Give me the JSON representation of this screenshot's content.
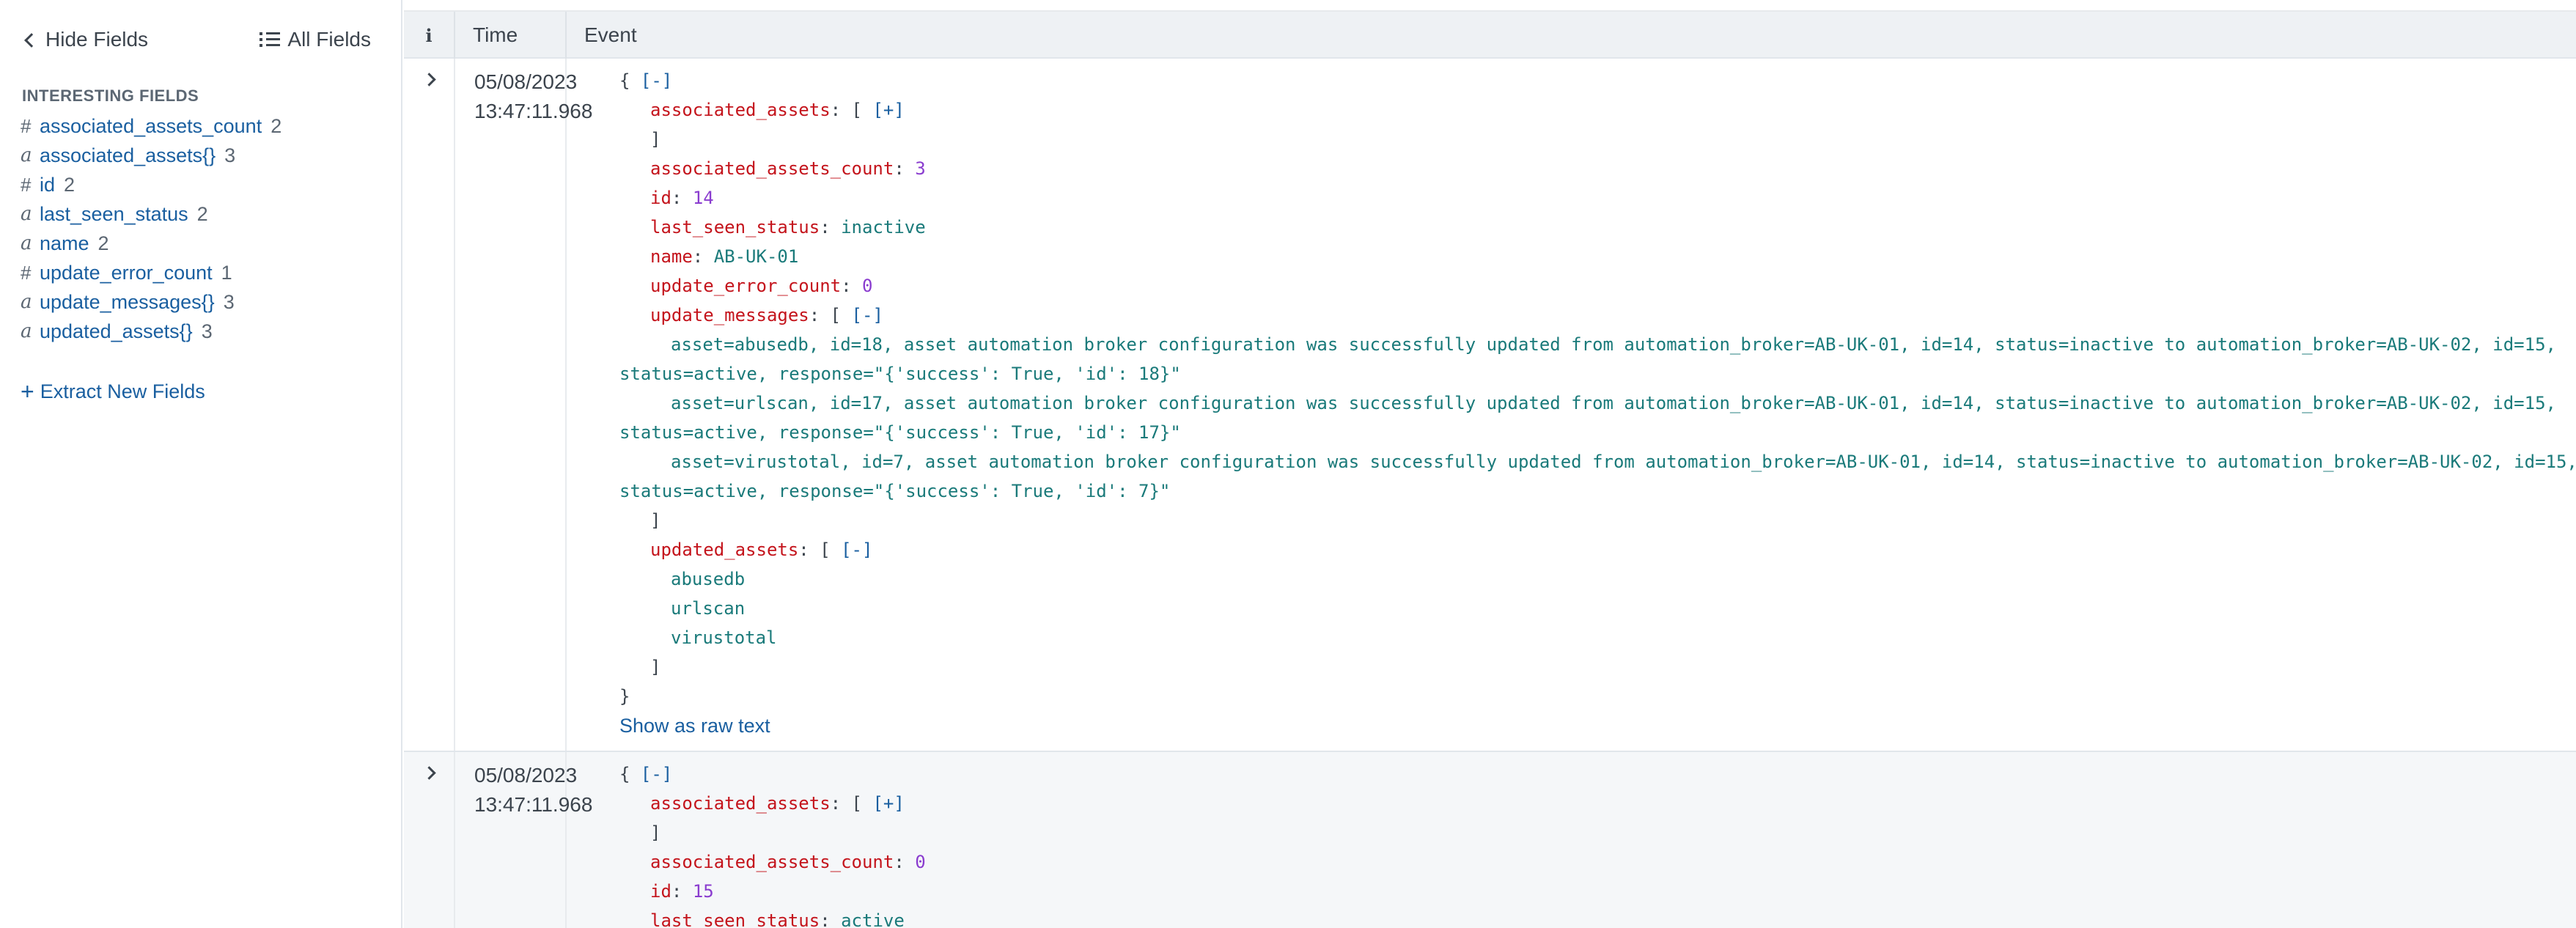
{
  "sidebar": {
    "hide_fields": "Hide Fields",
    "all_fields": "All Fields",
    "section_title": "INTERESTING FIELDS",
    "fields": [
      {
        "type": "#",
        "name": "associated_assets_count",
        "count": "2"
      },
      {
        "type": "a",
        "name": "associated_assets{}",
        "count": "3"
      },
      {
        "type": "#",
        "name": "id",
        "count": "2"
      },
      {
        "type": "a",
        "name": "last_seen_status",
        "count": "2"
      },
      {
        "type": "a",
        "name": "name",
        "count": "2"
      },
      {
        "type": "#",
        "name": "update_error_count",
        "count": "1"
      },
      {
        "type": "a",
        "name": "update_messages{}",
        "count": "3"
      },
      {
        "type": "a",
        "name": "updated_assets{}",
        "count": "3"
      }
    ],
    "extract": "Extract New Fields"
  },
  "table": {
    "col_info": "i",
    "col_time": "Time",
    "col_event": "Event"
  },
  "events": [
    {
      "date": "05/08/2023",
      "time": "13:47:11.968",
      "open_brace": "{",
      "collapse": "[-]",
      "expand": "[+]",
      "k_assoc": "associated_assets",
      "k_assoc_count": "associated_assets_count",
      "v_assoc_count": "3",
      "k_id": "id",
      "v_id": "14",
      "k_status": "last_seen_status",
      "v_status": "inactive",
      "k_name": "name",
      "v_name": "AB-UK-01",
      "k_err": "update_error_count",
      "v_err": "0",
      "k_msgs": "update_messages",
      "msgs": [
        {
          "a": "asset=abusedb, id=18, asset automation broker configuration was successfully updated from automation_broker=AB-UK-01, id=14, status=inactive to automation_broker=AB-UK-02, id=15,",
          "b": "status=active, response=\"{'success': True, 'id': 18}\""
        },
        {
          "a": "asset=urlscan, id=17, asset automation broker configuration was successfully updated from automation_broker=AB-UK-01, id=14, status=inactive to automation_broker=AB-UK-02, id=15,",
          "b": "status=active, response=\"{'success': True, 'id': 17}\""
        },
        {
          "a": "asset=virustotal, id=7, asset automation broker configuration was successfully updated from automation_broker=AB-UK-01, id=14, status=inactive to automation_broker=AB-UK-02, id=15,",
          "b": "status=active, response=\"{'success': True, 'id': 7}\""
        }
      ],
      "k_updated": "updated_assets",
      "updated": [
        "abusedb",
        "urlscan",
        "virustotal"
      ],
      "close_bracket": "]",
      "close_brace": "}",
      "raw": "Show as raw text"
    },
    {
      "date": "05/08/2023",
      "time": "13:47:11.968",
      "open_brace": "{",
      "collapse": "[-]",
      "expand": "[+]",
      "k_assoc": "associated_assets",
      "k_assoc_count": "associated_assets_count",
      "v_assoc_count": "0",
      "k_id": "id",
      "v_id": "15",
      "k_status": "last_seen_status",
      "v_status": "active",
      "close_bracket": "]"
    }
  ],
  "colors": {
    "key": "#c4141c",
    "number": "#8a3ccf",
    "string": "#1a7a7a",
    "link": "#1a5fa0"
  }
}
